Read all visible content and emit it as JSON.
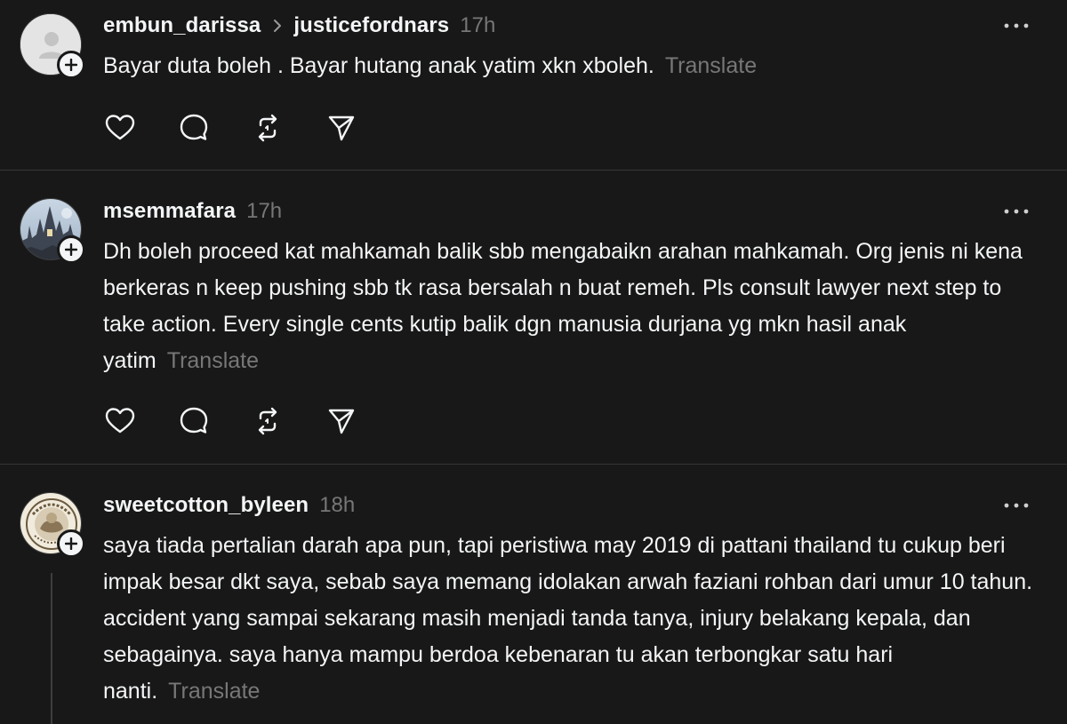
{
  "posts": [
    {
      "username": "embun_darissa",
      "reply_to": "justicefordnars",
      "time": "17h",
      "text": "Bayar duta boleh . Bayar hutang anak yatim xkn xboleh.",
      "translate_label": "Translate",
      "avatar": "default-avatar-icon"
    },
    {
      "username": "msemmafara",
      "time": "17h",
      "text": "Dh boleh proceed kat mahkamah balik sbb mengabaikn arahan mahkamah. Org jenis ni kena berkeras n keep pushing sbb tk rasa bersalah n buat remeh. Pls consult lawyer next step to take action. Every single cents kutip balik dgn manusia durjana yg mkn hasil anak yatim",
      "translate_label": "Translate",
      "avatar": "castle-photo-avatar"
    },
    {
      "username": "sweetcotton_byleen",
      "time": "18h",
      "text": "saya tiada pertalian darah apa pun, tapi peristiwa may 2019 di pattani thailand tu cukup beri impak besar dkt saya, sebab saya memang idolakan arwah faziani rohban dari umur 10 tahun. accident yang sampai sekarang masih menjadi tanda tanya, injury belakang kepala, dan sebagainya. saya hanya mampu berdoa kebenaran tu akan terbongkar satu hari nanti.",
      "translate_label": "Translate",
      "avatar": "sweet-cotton-logo-avatar"
    }
  ],
  "icons": {
    "like": "heart-icon",
    "comment": "comment-icon",
    "repost": "repost-icon",
    "share": "send-icon",
    "more": "more-icon",
    "follow": "plus-icon",
    "reply_chevron": "chevron-right-icon"
  },
  "colors": {
    "background": "#181818",
    "text_primary": "#f3f5f7",
    "text_secondary": "#777777",
    "divider": "#363636"
  }
}
